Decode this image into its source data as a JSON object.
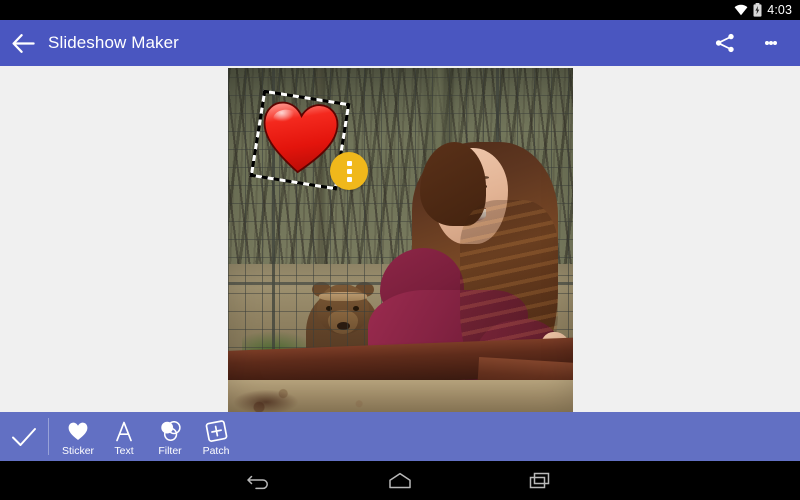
{
  "status_bar": {
    "clock": "4:03",
    "icons": [
      "wifi-icon",
      "battery-charging-icon"
    ]
  },
  "app_bar": {
    "title": "Slideshow Maker",
    "back_icon": "back-arrow-icon",
    "share_icon": "share-icon",
    "overflow_icon": "overflow-menu-icon",
    "background_color": "#4a56c0"
  },
  "editor": {
    "canvas_background": "#f0f0f0",
    "photo": {
      "description": "Girl in maroon hoodie standing at a wire fence with a brown bear behind it",
      "subjects": [
        "girl",
        "brown-bear",
        "wire-fence",
        "wooden-rail",
        "woods"
      ]
    },
    "sticker": {
      "type": "heart-sticker",
      "selected": true,
      "selection_style": "dashed",
      "rotation_degrees": 9,
      "color": "#e81b13",
      "menu_button": {
        "icon": "overflow-menu-icon",
        "color": "#f0b81b"
      }
    }
  },
  "toolbar": {
    "background_color": "#6270c3",
    "confirm": {
      "label": "Done",
      "icon": "checkmark-icon"
    },
    "tools": [
      {
        "label": "Sticker",
        "icon": "heart-icon"
      },
      {
        "label": "Text",
        "icon": "letter-a-icon"
      },
      {
        "label": "Filter",
        "icon": "overlapping-circles-icon"
      },
      {
        "label": "Patch",
        "icon": "square-plus-icon"
      }
    ]
  },
  "nav_bar": {
    "buttons": [
      {
        "name": "back",
        "icon": "nav-back-icon"
      },
      {
        "name": "home",
        "icon": "nav-home-icon"
      },
      {
        "name": "recents",
        "icon": "nav-recents-icon"
      }
    ]
  }
}
